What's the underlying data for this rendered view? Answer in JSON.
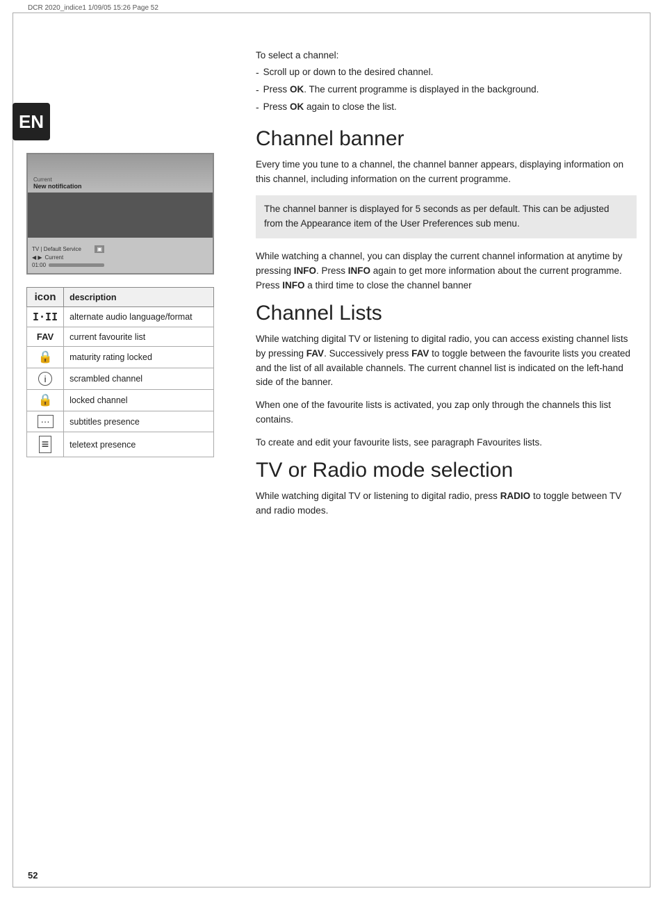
{
  "header": {
    "text": "DCR 2020_indice1  1/09/05  15:26  Page 52"
  },
  "en_badge": "EN",
  "page_number": "52",
  "tv_screen": {
    "label_small": "Current",
    "label_bold": "New notification",
    "bottom_label1": "TV  |  Default Service",
    "bottom_label2": "Current",
    "bottom_time": "01:00"
  },
  "icon_table": {
    "header_icon": "icon",
    "header_desc": "description",
    "rows": [
      {
        "icon": "⊞",
        "icon_type": "audio",
        "description": "alternate audio language/format"
      },
      {
        "icon": "FAV",
        "icon_type": "fav",
        "description": "current favourite list"
      },
      {
        "icon": "🔒",
        "icon_type": "lock1",
        "description": "maturity rating locked"
      },
      {
        "icon": "ℹ",
        "icon_type": "info",
        "description": "scrambled channel"
      },
      {
        "icon": "🔒",
        "icon_type": "lock2",
        "description": "locked channel"
      },
      {
        "icon": "⬜",
        "icon_type": "subtitles",
        "description": "subtitles presence"
      },
      {
        "icon": "≡",
        "icon_type": "teletext",
        "description": "teletext presence"
      }
    ]
  },
  "intro": {
    "label": "To select a channel:",
    "bullets": [
      {
        "text": "Scroll up or down to the desired channel."
      },
      {
        "text": "Press OK. The current programme is displayed in the background."
      },
      {
        "text": "Press OK again to close the list."
      }
    ]
  },
  "channel_banner": {
    "title": "Channel banner",
    "para1": "Every time you tune to a channel, the channel banner appears, displaying information on this channel, including information on the current programme.",
    "note": "The channel banner is displayed for 5 seconds as per default. This can be adjusted from the Appearance item of the User Preferences sub menu.",
    "para2": "While watching a channel, you can display the current channel information at anytime by pressing INFO. Press INFO again to get more information about the current programme. Press INFO a third time to close the channel banner"
  },
  "channel_lists": {
    "title": "Channel Lists",
    "para1": "While watching digital TV or listening to digital radio, you can access existing channel lists by pressing FAV. Successively press FAV to toggle between the favourite lists you created and the list of all available channels. The current channel list is indicated on the left-hand side of the banner.",
    "para2": "When one of the favourite lists is activated, you zap only through the channels this list contains.",
    "para3": "To create and edit your favourite lists, see paragraph Favourites lists."
  },
  "tv_radio": {
    "title": "TV or Radio mode selection",
    "para1": "While watching digital TV or listening to digital radio, press RADIO to toggle between TV and radio modes."
  }
}
